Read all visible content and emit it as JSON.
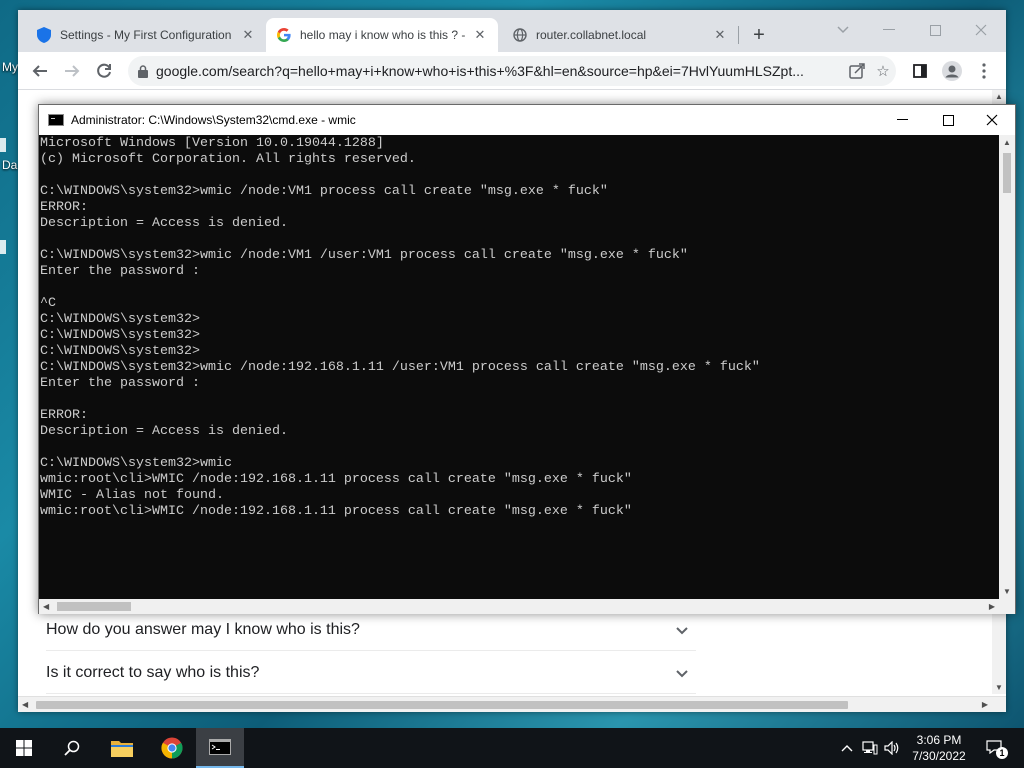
{
  "desktop": {
    "labels": [
      "My",
      "Da"
    ]
  },
  "browser": {
    "tabs": [
      {
        "title": "Settings - My First Configuration",
        "icon": "shield-icon",
        "active": false
      },
      {
        "title": "hello may i know who is this ? - Goo",
        "icon": "google-icon",
        "active": true
      },
      {
        "title": "router.collabnet.local",
        "icon": "globe-icon",
        "active": false
      }
    ],
    "url": "google.com/search?q=hello+may+i+know+who+is+this+%3F&hl=en&source=hp&ei=7HvlYuumHLSZpt...",
    "faq": [
      "How do you answer may I know who is this?",
      "Is it correct to say who is this?"
    ]
  },
  "cmd": {
    "title": "Administrator: C:\\Windows\\System32\\cmd.exe - wmic",
    "lines": [
      "Microsoft Windows [Version 10.0.19044.1288]",
      "(c) Microsoft Corporation. All rights reserved.",
      "",
      "C:\\WINDOWS\\system32>wmic /node:VM1 process call create \"msg.exe * fuck\"",
      "ERROR:",
      "Description = Access is denied.",
      "",
      "C:\\WINDOWS\\system32>wmic /node:VM1 /user:VM1 process call create \"msg.exe * fuck\"",
      "Enter the password :",
      "",
      "^C",
      "C:\\WINDOWS\\system32>",
      "C:\\WINDOWS\\system32>",
      "C:\\WINDOWS\\system32>",
      "C:\\WINDOWS\\system32>wmic /node:192.168.1.11 /user:VM1 process call create \"msg.exe * fuck\"",
      "Enter the password :",
      "",
      "ERROR:",
      "Description = Access is denied.",
      "",
      "C:\\WINDOWS\\system32>wmic",
      "wmic:root\\cli>WMIC /node:192.168.1.11 process call create \"msg.exe * fuck\"",
      "WMIC - Alias not found.",
      "wmic:root\\cli>WMIC /node:192.168.1.11 process call create \"msg.exe * fuck\""
    ]
  },
  "taskbar": {
    "time": "3:06 PM",
    "date": "7/30/2022",
    "notification_count": "1"
  }
}
